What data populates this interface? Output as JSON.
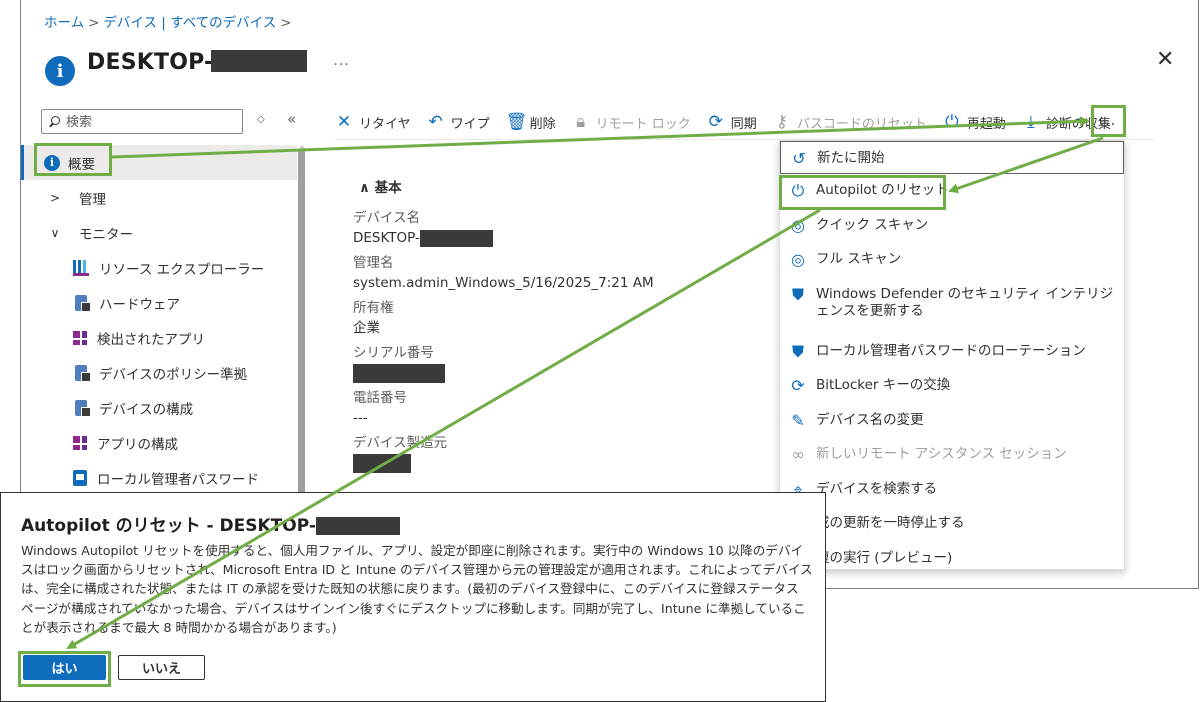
{
  "breadcrumb": {
    "home": "ホーム",
    "devices": "デバイス | すべてのデバイス",
    "sep": ">"
  },
  "page": {
    "title": "DESKTOP-",
    "more": "...",
    "close": "✕"
  },
  "search": {
    "placeholder": "検索"
  },
  "sidebar": {
    "overview": "概要",
    "manage": "管理",
    "monitor": "モニター",
    "items": [
      {
        "label": "リソース エクスプローラー",
        "icon": "resource-explorer-icon"
      },
      {
        "label": "ハードウェア",
        "icon": "hardware-icon"
      },
      {
        "label": "検出されたアプリ",
        "icon": "discovered-apps-icon"
      },
      {
        "label": "デバイスのポリシー準拠",
        "icon": "device-compliance-icon"
      },
      {
        "label": "デバイスの構成",
        "icon": "device-configuration-icon"
      },
      {
        "label": "アプリの構成",
        "icon": "app-configuration-icon"
      },
      {
        "label": "ローカル管理者パスワード",
        "icon": "local-admin-password-icon"
      }
    ]
  },
  "toolbar": {
    "retire": "リタイヤ",
    "wipe": "ワイプ",
    "delete": "削除",
    "remote_lock": "リモート ロック",
    "sync": "同期",
    "reset_passcode": "パスコードのリセット",
    "restart": "再起動",
    "collect_diag": "診断の収集",
    "more": "..."
  },
  "essentials": {
    "header": "基本",
    "device_name_label": "デバイス名",
    "device_name_value": "DESKTOP-",
    "mgmt_name_label": "管理名",
    "mgmt_name_value": "system.admin_Windows_5/16/2025_7:21 AM",
    "ownership_label": "所有権",
    "ownership_value": "企業",
    "serial_label": "シリアル番号",
    "phone_label": "電話番号",
    "phone_value": "---",
    "manufacturer_label": "デバイス製造元"
  },
  "menu": [
    {
      "label": "新たに開始",
      "icon": "fresh-start-icon",
      "enabled": true
    },
    {
      "label": "Autopilot のリセット",
      "icon": "power-icon",
      "enabled": true
    },
    {
      "label": "クイック スキャン",
      "icon": "scan-icon",
      "enabled": true
    },
    {
      "label": "フル スキャン",
      "icon": "scan-icon",
      "enabled": true
    },
    {
      "label": "Windows Defender のセキュリティ インテリジェンスを更新する",
      "icon": "defender-icon",
      "enabled": true
    },
    {
      "label": "ローカル管理者パスワードのローテーション",
      "icon": "defender-icon",
      "enabled": true
    },
    {
      "label": "BitLocker キーの交換",
      "icon": "rotate-icon",
      "enabled": true
    },
    {
      "label": "デバイス名の変更",
      "icon": "pencil-icon",
      "enabled": true
    },
    {
      "label": "新しいリモート アシスタンス セッション",
      "icon": "link-icon",
      "enabled": false
    },
    {
      "label": "デバイスを検索する",
      "icon": "location-icon",
      "enabled": true
    },
    {
      "label": "成の更新を一時停止する",
      "icon": "",
      "enabled": true
    },
    {
      "label": "復の実行 (プレビュー)",
      "icon": "",
      "enabled": true
    }
  ],
  "dialog": {
    "title": "Autopilot のリセット - DESKTOP-",
    "body": "Windows Autopilot リセットを使用すると、個人用ファイル、アプリ、設定が即座に削除されます。実行中の Windows 10 以降のデバイスはロック画面からリセットされ、Microsoft Entra ID と Intune のデバイス管理から元の管理設定が適用されます。これによってデバイスは、完全に構成された状態、または IT の承認を受けた既知の状態に戻ります。(最初のデバイス登録中に、このデバイスに登録ステータス ページが構成されていなかった場合、デバイスはサインイン後すぐにデスクトップに移動します。同期が完了し、Intune に準拠していることが表示されるまで最大 8 時間かかる場合があります。)",
    "yes": "はい",
    "no": "いいえ"
  },
  "colors": {
    "accent": "#0f6cbd",
    "annotation": "#70ad47"
  }
}
